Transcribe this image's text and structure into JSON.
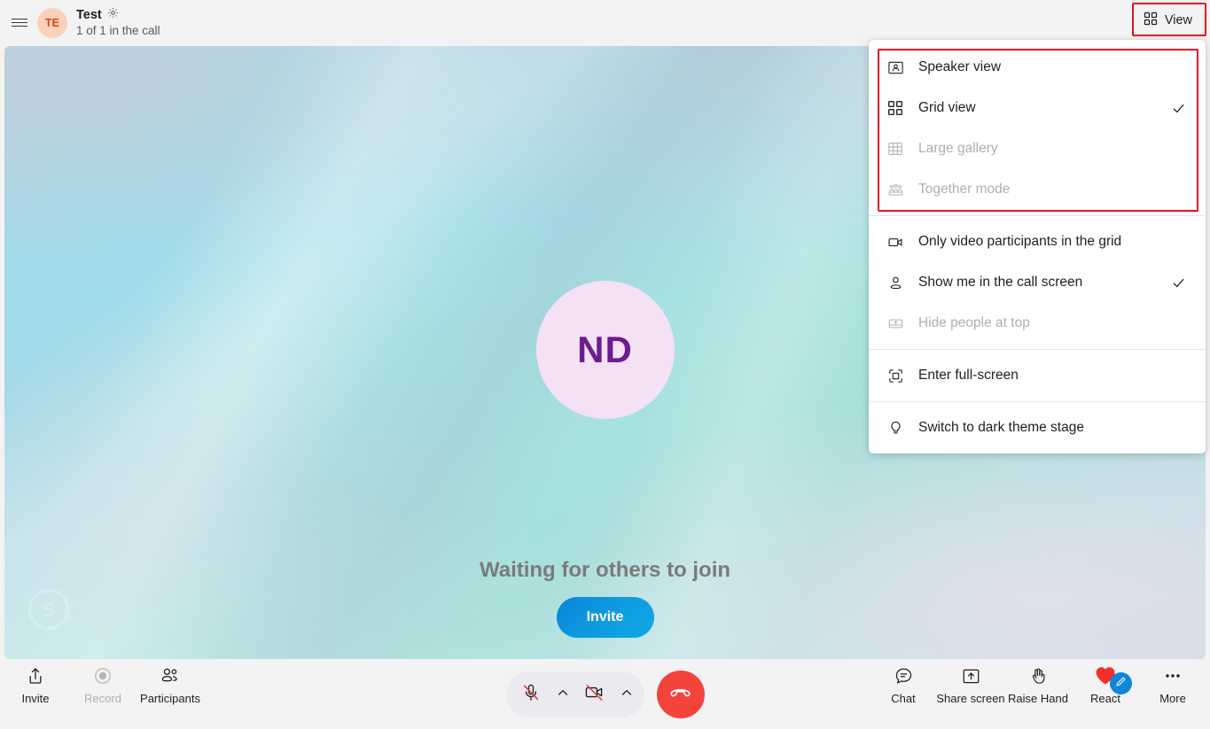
{
  "header": {
    "menu_icon": "hamburger-icon",
    "avatar_initials": "TE",
    "title": "Test",
    "settings_icon": "gear-icon",
    "subtitle": "1 of 1 in the call",
    "view_button": {
      "label": "View",
      "icon": "grid-icon",
      "highlighted": true,
      "highlight_color": "#e81123"
    }
  },
  "stage": {
    "watermark_icon": "skype-logo-icon",
    "participant": {
      "avatar_initials": "ND",
      "avatar_bg": "#f5e1f4",
      "avatar_text_color": "#6b1d8e"
    },
    "waiting_text": "Waiting for others to join",
    "invite_cta": "Invite",
    "invite_cta_color": "#0e9de0"
  },
  "view_menu": {
    "highlight_color": "#e81123",
    "groups": [
      {
        "highlighted": true,
        "items": [
          {
            "icon": "speaker-view-icon",
            "label": "Speaker view",
            "checked": false,
            "disabled": false
          },
          {
            "icon": "grid-view-icon",
            "label": "Grid view",
            "checked": true,
            "disabled": false
          },
          {
            "icon": "large-gallery-icon",
            "label": "Large gallery",
            "checked": false,
            "disabled": true
          },
          {
            "icon": "together-mode-icon",
            "label": "Together mode",
            "checked": false,
            "disabled": true
          }
        ]
      },
      {
        "highlighted": false,
        "items": [
          {
            "icon": "video-camera-icon",
            "label": "Only video participants in the grid",
            "checked": false,
            "disabled": false
          },
          {
            "icon": "person-icon",
            "label": "Show me in the call screen",
            "checked": true,
            "disabled": false
          },
          {
            "icon": "hide-people-icon",
            "label": "Hide people at top",
            "checked": false,
            "disabled": true
          }
        ]
      },
      {
        "highlighted": false,
        "items": [
          {
            "icon": "fullscreen-icon",
            "label": "Enter full-screen",
            "checked": false,
            "disabled": false
          }
        ]
      },
      {
        "highlighted": false,
        "items": [
          {
            "icon": "lightbulb-icon",
            "label": "Switch to dark theme stage",
            "checked": false,
            "disabled": false
          }
        ]
      }
    ]
  },
  "toolbar": {
    "left": [
      {
        "icon": "share-invite-icon",
        "label": "Invite",
        "disabled": false
      },
      {
        "icon": "record-icon",
        "label": "Record",
        "disabled": true
      },
      {
        "icon": "participants-icon",
        "label": "Participants",
        "disabled": false
      }
    ],
    "center": {
      "mic": {
        "icon": "microphone-muted-icon",
        "muted": true,
        "label": "Mute"
      },
      "mic_caret": {
        "icon": "chevron-up-icon"
      },
      "camera": {
        "icon": "camera-off-icon",
        "off": true,
        "label": "Camera"
      },
      "camera_caret": {
        "icon": "chevron-up-icon"
      },
      "hangup": {
        "icon": "hangup-phone-icon",
        "color": "#f4433b",
        "label": "End call"
      }
    },
    "right": [
      {
        "icon": "chat-icon",
        "label": "Chat",
        "disabled": false
      },
      {
        "icon": "share-screen-icon",
        "label": "Share screen",
        "disabled": false
      },
      {
        "icon": "raise-hand-icon",
        "label": "Raise Hand",
        "disabled": false
      },
      {
        "icon": "heart-react-icon",
        "label": "React",
        "disabled": false,
        "badge_icon": "pencil-icon",
        "badge_color": "#0f86d8"
      },
      {
        "icon": "more-ellipsis-icon",
        "label": "More",
        "disabled": false
      }
    ]
  }
}
